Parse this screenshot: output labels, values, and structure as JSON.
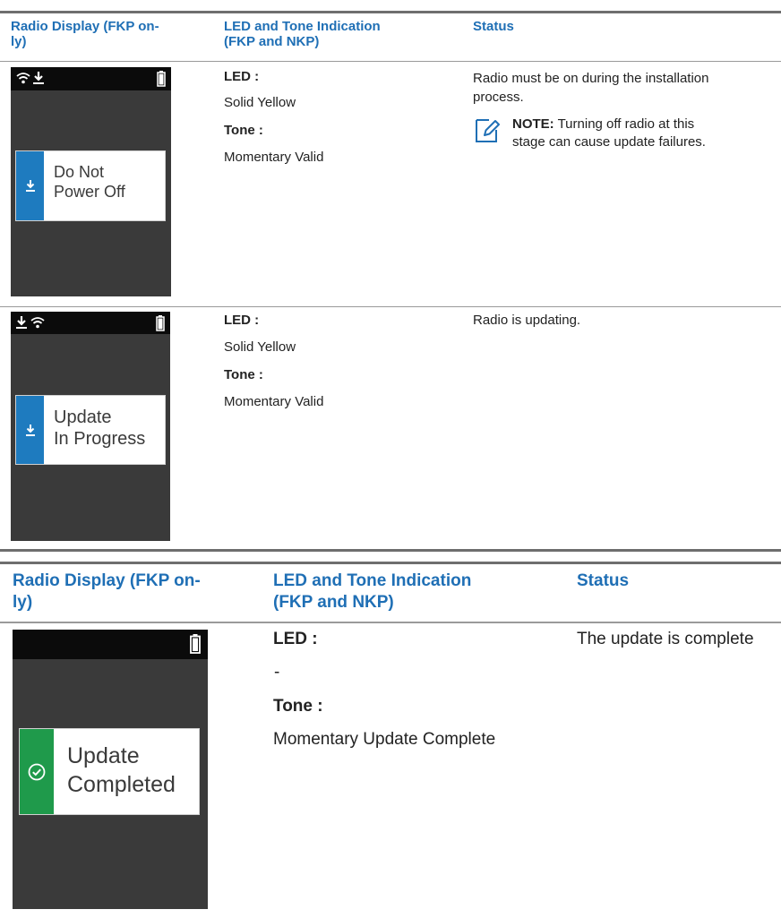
{
  "table1": {
    "headers": {
      "display": "Radio Display (FKP on-ly)",
      "display_l1": "Radio Display (FKP on-",
      "display_l2": "ly)",
      "led_tone_l1": "LED and Tone Indication",
      "led_tone_l2": "(FKP and NKP)",
      "status": "Status"
    },
    "rows": [
      {
        "screen_text_l1": "Do Not",
        "screen_text_l2": "Power Off",
        "led_label": "LED :",
        "led_value": "Solid Yellow",
        "tone_label": "Tone :",
        "tone_value": "Momentary Valid",
        "status_l1": "Radio must be on during the installation",
        "status_l2": "process.",
        "note_label": "NOTE:",
        "note_l1": "Turning off radio at this",
        "note_l2": "stage can cause update failures."
      },
      {
        "screen_text_l1": "Update",
        "screen_text_l2": "In Progress",
        "led_label": "LED :",
        "led_value": "Solid Yellow",
        "tone_label": "Tone :",
        "tone_value": "Momentary Valid",
        "status": "Radio is updating."
      }
    ]
  },
  "table2": {
    "headers": {
      "display_l1": "Radio Display (FKP on-",
      "display_l2": "ly)",
      "led_tone_l1": "LED and Tone Indication",
      "led_tone_l2": "(FKP and NKP)",
      "status": "Status"
    },
    "row": {
      "screen_text_l1": "Update",
      "screen_text_l2": "Completed",
      "led_label": "LED :",
      "led_value": "-",
      "tone_label": "Tone :",
      "tone_value": "Momentary Update Complete",
      "status": "The update is complete"
    }
  },
  "colors": {
    "header_blue": "#1f6fb5",
    "strip_blue": "#1e7bbf",
    "strip_green": "#1f9a4b",
    "screen_bg": "#3a3a3a"
  },
  "icons": [
    "wifi-icon",
    "download-icon",
    "battery-icon",
    "note-icon",
    "checkmark-circle-icon"
  ]
}
